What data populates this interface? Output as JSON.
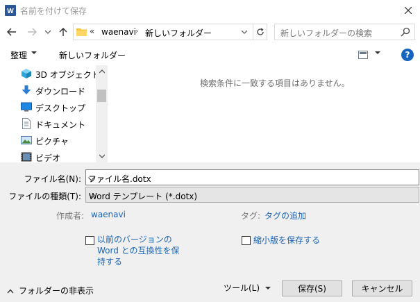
{
  "window": {
    "title": "名前を付けて保存",
    "app_icon": "word-icon"
  },
  "nav": {
    "back_icon": "arrow-left-icon",
    "forward_icon": "arrow-right-icon",
    "up_icon": "arrow-up-icon",
    "address": {
      "overflow": "«",
      "segments": [
        "waenavi",
        "新しいフォルダー"
      ],
      "separator": "›"
    },
    "search_placeholder": "新しいフォルダーの検索"
  },
  "toolbar": {
    "organize": "整理",
    "new_folder": "新しいフォルダー",
    "help": "?"
  },
  "sidebar": {
    "items": [
      {
        "label": "3D オブジェクト",
        "icon": "cube-3d-icon"
      },
      {
        "label": "ダウンロード",
        "icon": "download-icon"
      },
      {
        "label": "デスクトップ",
        "icon": "desktop-icon"
      },
      {
        "label": "ドキュメント",
        "icon": "document-icon"
      },
      {
        "label": "ピクチャ",
        "icon": "pictures-icon"
      },
      {
        "label": "ビデオ",
        "icon": "video-icon"
      }
    ]
  },
  "content": {
    "empty_message": "検索条件に一致する項目はありません。"
  },
  "form": {
    "filename_label": "ファイル名(N):",
    "filename_value": "ファイル名.dotx",
    "filetype_label": "ファイルの種類(T):",
    "filetype_value": "Word テンプレート (*.dotx)",
    "author_label": "作成者:",
    "author_value": "waenavi",
    "tags_label": "タグ:",
    "tags_value": "タグの追加",
    "compat_label": "以前のバージョンの Word との互換性を保持する",
    "thumbnail_label": "縮小版を保存する"
  },
  "footer": {
    "hide_folders": "フォルダーの非表示",
    "tools": "ツール(L)",
    "save": "保存(S)",
    "cancel": "キャンセル"
  },
  "colors": {
    "accent_link": "#1a64b4",
    "help_circle": "#1565c0",
    "dialog_bg": "#f0f0f0"
  }
}
